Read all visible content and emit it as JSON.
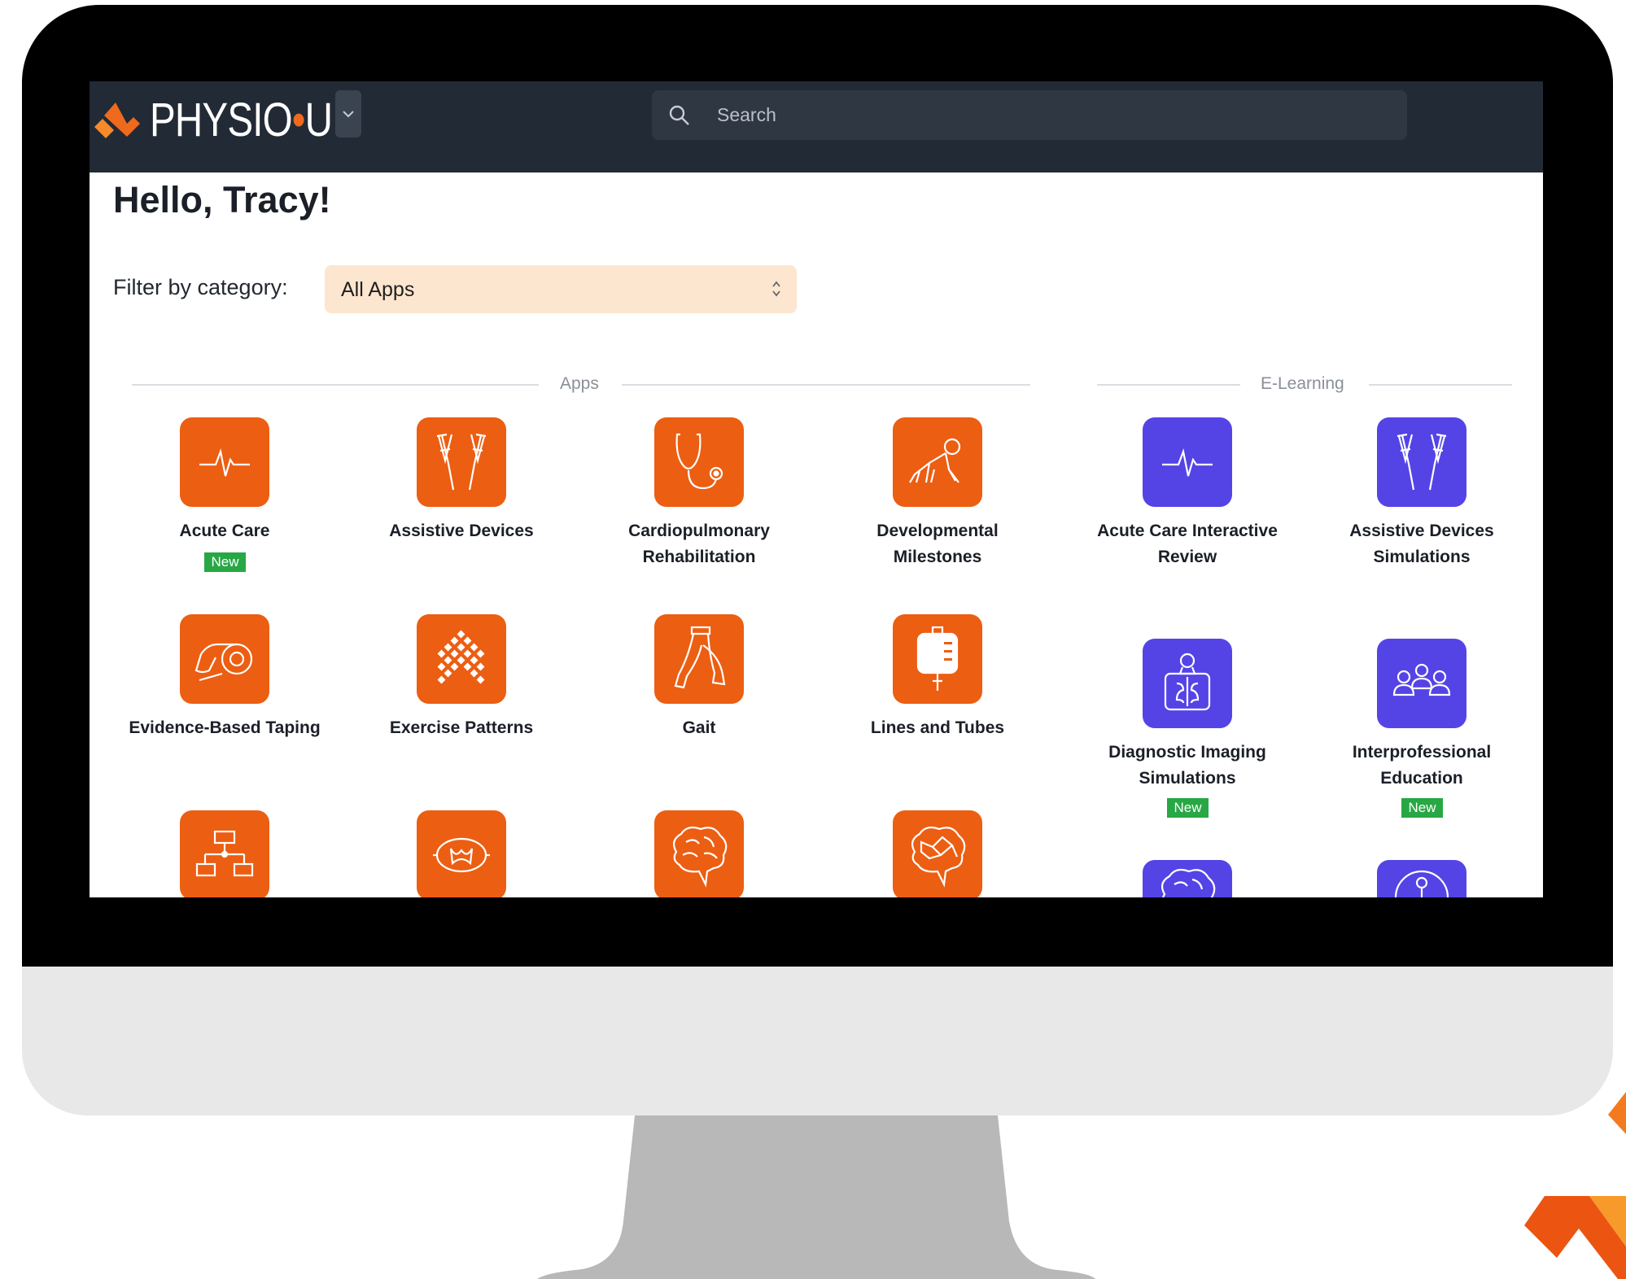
{
  "header": {
    "brand_prefix": "PHYSIO",
    "brand_dot": "•",
    "brand_suffix": "U",
    "search_placeholder": "Search"
  },
  "greeting": "Hello, Tracy!",
  "filter": {
    "label": "Filter by category:",
    "value": "All Apps"
  },
  "sections": {
    "apps": "Apps",
    "elearning": "E-Learning"
  },
  "apps": [
    {
      "label": "Acute Care",
      "badge": "New",
      "icon": "heartbeat-icon"
    },
    {
      "label": "Assistive Devices",
      "icon": "crutches-icon"
    },
    {
      "label": "Cardiopulmonary Rehabilitation",
      "icon": "stethoscope-icon"
    },
    {
      "label": "Developmental Milestones",
      "icon": "crawling-baby-icon"
    },
    {
      "label": "Evidence-Based Taping",
      "icon": "tape-roll-icon"
    },
    {
      "label": "Exercise Patterns",
      "icon": "pattern-grid-icon"
    },
    {
      "label": "Gait",
      "icon": "walking-legs-icon"
    },
    {
      "label": "Lines and Tubes",
      "icon": "iv-bag-icon"
    },
    {
      "label": "",
      "icon": "flowchart-icon"
    },
    {
      "label": "",
      "icon": "spinal-cord-icon"
    },
    {
      "label": "",
      "icon": "brain-icon"
    },
    {
      "label": "",
      "icon": "neural-brain-icon"
    }
  ],
  "elearning": [
    {
      "label": "Acute Care Interactive Review",
      "icon": "heartbeat-icon"
    },
    {
      "label": "Assistive Devices Simulations",
      "icon": "crutches-icon"
    },
    {
      "label": "Diagnostic Imaging Simulations",
      "badge": "New",
      "icon": "xray-icon"
    },
    {
      "label": "Interprofessional Education",
      "badge": "New",
      "icon": "group-icon"
    },
    {
      "label": "",
      "icon": "brain-icon"
    },
    {
      "label": "",
      "icon": "anatomy-icon"
    }
  ],
  "colors": {
    "app_tile": "#ec5e12",
    "elearning_tile": "#5444e6",
    "badge": "#27a844",
    "topbar": "#222a36",
    "filter_bg": "#fde6cf"
  }
}
